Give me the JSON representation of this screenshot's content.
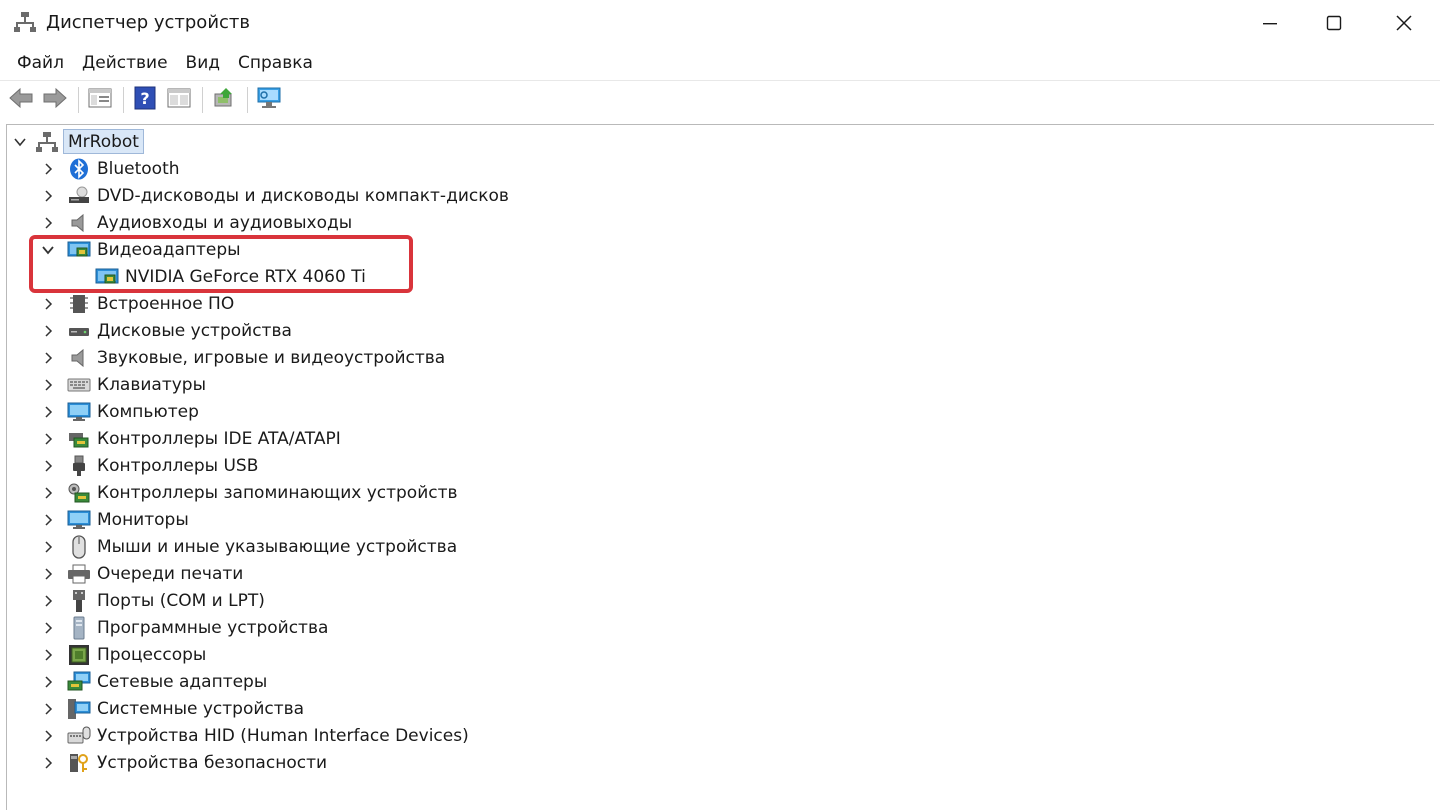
{
  "window": {
    "title": "Диспетчер устройств"
  },
  "menu": {
    "items": [
      "Файл",
      "Действие",
      "Вид",
      "Справка"
    ]
  },
  "toolbar": {
    "buttons": [
      "back-icon",
      "forward-icon",
      "properties-icon",
      "help-icon",
      "details-icon",
      "update-driver-icon",
      "scan-hardware-icon"
    ]
  },
  "tree": {
    "root": "MrRobot",
    "categories": [
      "Bluetooth",
      "DVD-дисководы и дисководы компакт-дисков",
      "Аудиовходы и аудиовыходы",
      "Видеоадаптеры",
      "Встроенное ПО",
      "Дисковые устройства",
      "Звуковые, игровые и видеоустройства",
      "Клавиатуры",
      "Компьютер",
      "Контроллеры IDE ATA/ATAPI",
      "Контроллеры USB",
      "Контроллеры запоминающих устройств",
      "Мониторы",
      "Мыши и иные указывающие устройства",
      "Очереди печати",
      "Порты (COM и LPT)",
      "Программные устройства",
      "Процессоры",
      "Сетевые адаптеры",
      "Системные устройства",
      "Устройства HID (Human Interface Devices)",
      "Устройства безопасности"
    ],
    "video_child": "NVIDIA GeForce RTX 4060 Ti"
  },
  "colors": {
    "highlight": "#d9343b",
    "selection": "#d9e7f7"
  }
}
